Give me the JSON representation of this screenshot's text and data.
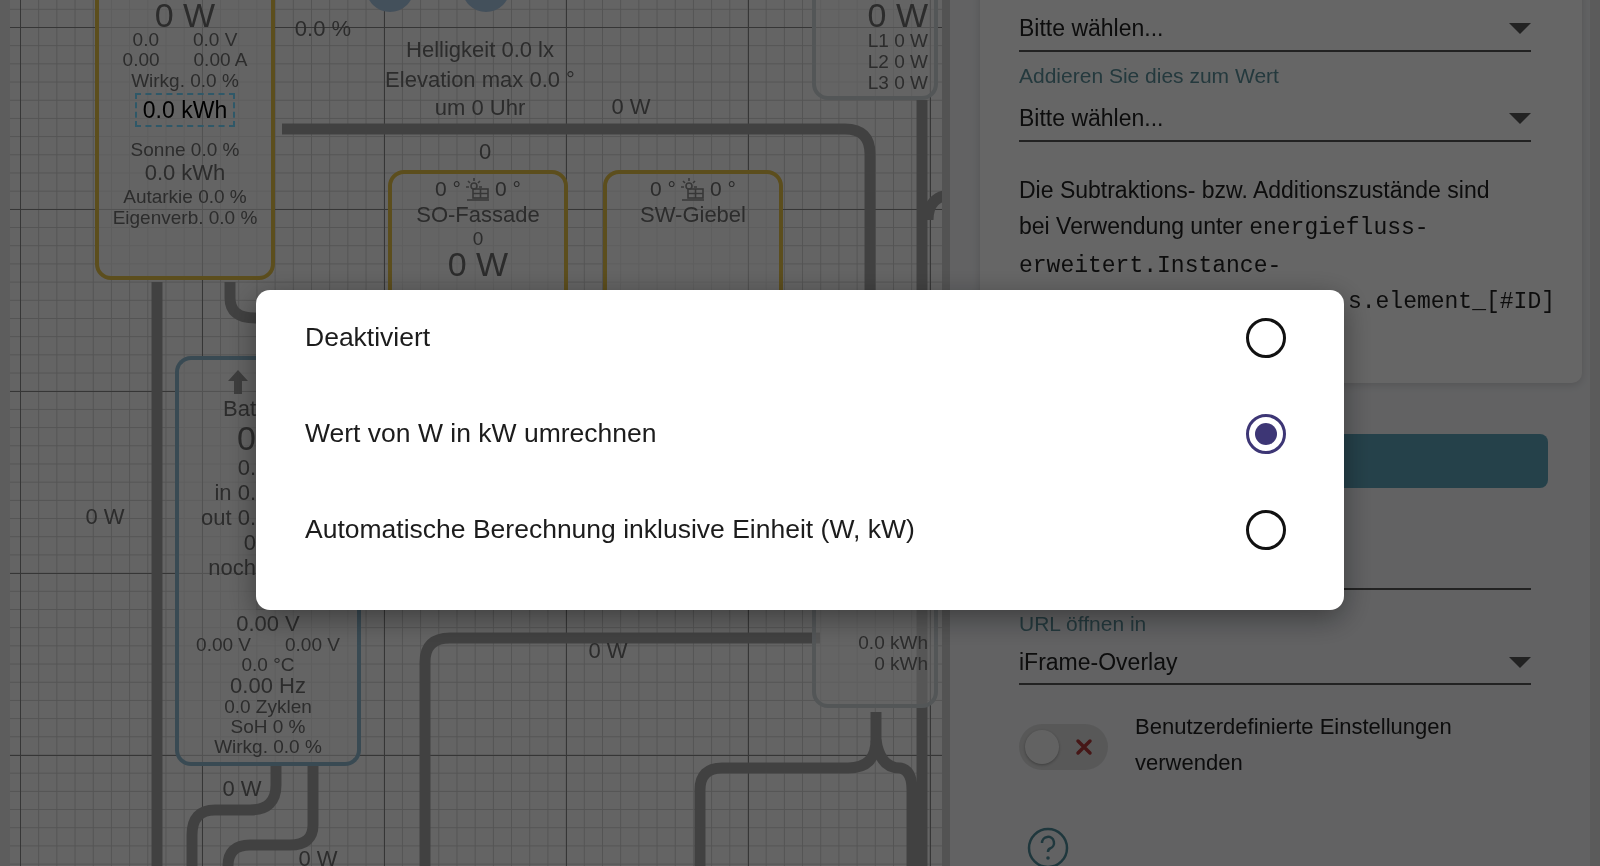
{
  "canvas": {
    "nodes": [
      {
        "kind": "source",
        "lines": [
          {
            "kind": "big",
            "text": "0 W",
            "selected": false
          },
          {
            "kind": "pair",
            "cells": [
              "0.0",
              "0.0 V"
            ],
            "selected": false
          },
          {
            "kind": "pair",
            "cells": [
              "0.00",
              "0.00 A"
            ],
            "selected": false
          },
          {
            "kind": "text",
            "text": "Wirkg. 0.0 %",
            "selected": false
          },
          {
            "kind": "mid",
            "text": "0.0 kWh",
            "selected": true
          },
          {
            "kind": "text",
            "text": "Sonne 0.0 %",
            "selected": false
          },
          {
            "kind": "mid",
            "text": "0.0 kWh",
            "selected": false
          },
          {
            "kind": "text",
            "text": "Autarkie 0.0 %",
            "selected": false
          },
          {
            "kind": "text",
            "text": "Eigenverb. 0.0 %",
            "selected": false
          }
        ]
      },
      {
        "kind": "solar",
        "lines": [
          {
            "kind": "panel-row",
            "cells": [
              "0 °",
              "0 °"
            ],
            "selected": false
          },
          {
            "kind": "mid",
            "text": "SO-Fassade",
            "selected": false
          },
          {
            "kind": "text",
            "text": "0",
            "selected": false
          },
          {
            "kind": "big",
            "text": "0 W",
            "selected": false
          }
        ]
      },
      {
        "kind": "solar",
        "lines": [
          {
            "kind": "panel-row",
            "cells": [
              "0 °",
              "0 °"
            ],
            "selected": false
          },
          {
            "kind": "mid",
            "text": "SW-Giebel",
            "selected": false
          }
        ]
      },
      {
        "kind": "meter",
        "lines": [
          {
            "kind": "big",
            "text": "0 W",
            "selected": false
          },
          {
            "kind": "text",
            "text": "L1 0 W",
            "selected": false
          },
          {
            "kind": "text",
            "text": "L2 0 W",
            "selected": false
          },
          {
            "kind": "text",
            "text": "L3 0 W",
            "selected": false
          }
        ]
      },
      {
        "kind": "battery",
        "lines": [
          {
            "kind": "clipped",
            "text": "Bat",
            "selected": false
          },
          {
            "kind": "clipped-big",
            "text": "0",
            "selected": false
          },
          {
            "kind": "clipped",
            "text": "0.",
            "selected": false
          },
          {
            "kind": "clipped",
            "text": "in 0.",
            "selected": false
          },
          {
            "kind": "clipped",
            "text": "out 0.",
            "selected": false
          },
          {
            "kind": "clipped",
            "text": "0",
            "selected": false
          },
          {
            "kind": "clipped",
            "text": "noch",
            "selected": false
          },
          {
            "kind": "mid",
            "text": "0.00 V",
            "selected": false
          },
          {
            "kind": "pair",
            "cells": [
              "0.00 V",
              "0.00 V"
            ],
            "selected": false
          },
          {
            "kind": "text",
            "text": "0.0 °C",
            "selected": false
          },
          {
            "kind": "mid",
            "text": "0.00 Hz",
            "selected": false
          },
          {
            "kind": "text",
            "text": "0.0 Zyklen",
            "selected": false
          },
          {
            "kind": "text",
            "text": "SoH 0 %",
            "selected": false
          },
          {
            "kind": "text",
            "text": "Wirkg. 0.0 %",
            "selected": false
          }
        ]
      },
      {
        "kind": "meter",
        "lines": [
          {
            "kind": "text",
            "text": "0.0 kWh",
            "selected": false
          },
          {
            "kind": "text",
            "text": "0 kWh",
            "selected": false
          }
        ]
      }
    ],
    "labels": [
      "0.0 %",
      "Helligkeit 0.0 lx",
      "Elevation max 0.0 °",
      "um 0 Uhr",
      "0 W",
      "0",
      "0 W",
      "0 W",
      "0 W",
      "0 W"
    ]
  },
  "panel": {
    "select_1": {
      "value": "Bitte wählen..."
    },
    "select_2": {
      "label": "Addieren Sie dies zum Wert",
      "value": "Bitte wählen..."
    },
    "note": {
      "text": "Die Subtraktions- bzw. Additionszustände sind bei Verwendung unter",
      "code": "energiefluss-erweitert.Instance-",
      "code_tail": "s.element_[#ID]"
    },
    "url_target": {
      "label": "URL öffnen in",
      "value": "iFrame-Overlay"
    },
    "custom_settings": {
      "label": "Benutzerdefinierte Einstellungen verwenden",
      "on": false
    }
  },
  "dialog": {
    "options": [
      {
        "label": "Deaktiviert",
        "selected": false
      },
      {
        "label": "Wert von W in kW umrechnen",
        "selected": true
      },
      {
        "label": "Automatische Berechnung inklusive Einheit (W, kW)",
        "selected": false
      }
    ]
  }
}
